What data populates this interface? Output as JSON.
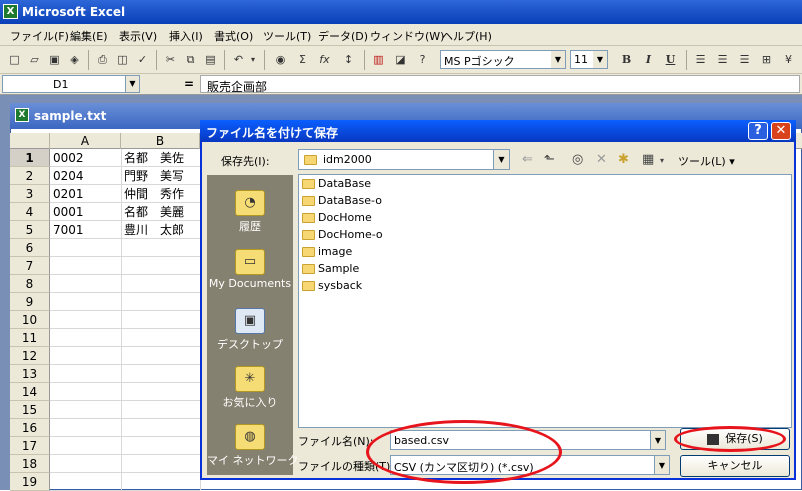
{
  "app": {
    "title": "Microsoft Excel",
    "icon": "excel-icon"
  },
  "menu": [
    "ファイル(F)",
    "編集(E)",
    "表示(V)",
    "挿入(I)",
    "書式(O)",
    "ツール(T)",
    "データ(D)",
    "ウィンドウ(W)",
    "ヘルプ(H)"
  ],
  "toolbar": {
    "font_name": "MS Pゴシック",
    "font_size": "11",
    "bold": "B",
    "italic": "I",
    "underline": "U"
  },
  "formula_bar": {
    "name_box": "D1",
    "equals": "=",
    "value": "販売企画部"
  },
  "workbook": {
    "title": "sample.txt",
    "columns": [
      "A",
      "B"
    ],
    "rows": [
      "1",
      "2",
      "3",
      "4",
      "5",
      "6",
      "7",
      "8",
      "9",
      "10",
      "11",
      "12",
      "13",
      "14",
      "15",
      "16",
      "17",
      "18",
      "19"
    ],
    "cells": [
      {
        "a": "0002",
        "b": "名都　美佐"
      },
      {
        "a": "0204",
        "b": "門野　美写"
      },
      {
        "a": "0201",
        "b": "仲間　秀作"
      },
      {
        "a": "0001",
        "b": "名都　美麗"
      },
      {
        "a": "7001",
        "b": "豊川　太郎"
      }
    ]
  },
  "dialog": {
    "title": "ファイル名を付けて保存",
    "save_in_label": "保存先(I):",
    "location": "idm2000",
    "tools_label": "ツール(L) ▾",
    "places": [
      {
        "label": "履歴",
        "icon": "history-icon"
      },
      {
        "label": "My Documents",
        "icon": "my-documents-icon"
      },
      {
        "label": "デスクトップ",
        "icon": "desktop-icon"
      },
      {
        "label": "お気に入り",
        "icon": "favorites-icon"
      },
      {
        "label": "マイ ネットワーク",
        "icon": "network-icon"
      }
    ],
    "folders": [
      "DataBase",
      "DataBase-o",
      "DocHome",
      "DocHome-o",
      "image",
      "Sample",
      "sysback"
    ],
    "file_name_label": "ファイル名(N):",
    "file_name_value": "based.csv",
    "file_type_label": "ファイルの種類(T):",
    "file_type_value": "CSV (カンマ区切り) (*.csv)",
    "save_button": "保存(S)",
    "cancel_button": "キャンセル"
  },
  "colors": {
    "title_blue": "#0a5fff",
    "highlight_red": "#e8141c",
    "folder_yellow": "#f6d774"
  }
}
